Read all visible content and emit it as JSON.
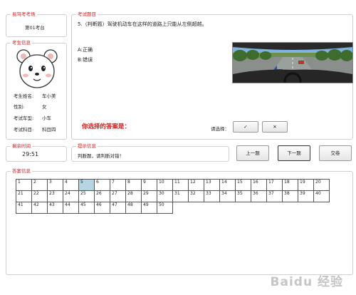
{
  "exam_site": {
    "legend": "易驾考考场",
    "seat": "第01考台"
  },
  "examinee": {
    "legend": "考生信息",
    "fields": [
      {
        "label": "考生姓名:",
        "value": "车小美"
      },
      {
        "label": "性别:",
        "value": "女"
      },
      {
        "label": "考试车型:",
        "value": "小车"
      },
      {
        "label": "考试科目:",
        "value": "科目四"
      }
    ]
  },
  "question": {
    "legend": "考试题目",
    "text": "5.（判断题）驾驶机动车在这样的道路上只能从左侧超越。",
    "options": [
      "A:正确",
      "B:错误"
    ],
    "your_answer_label": "你选择的答案是：",
    "select_label": "请选择：",
    "correct_symbol": "✓",
    "wrong_symbol": "✕"
  },
  "timer": {
    "legend": "剩余时间",
    "value": "29:51"
  },
  "hint": {
    "legend": "提示信息",
    "text": "判断题，请判断对错！"
  },
  "nav": {
    "prev": "上一题",
    "next": "下一题",
    "submit": "交卷"
  },
  "answers": {
    "legend": "答案信息",
    "total": 50,
    "per_row": 20,
    "current": 5
  },
  "colors": {
    "accent_red": "#d21f1f",
    "selected_cell": "#b7d4e2"
  },
  "watermark": "Baidu 经验"
}
